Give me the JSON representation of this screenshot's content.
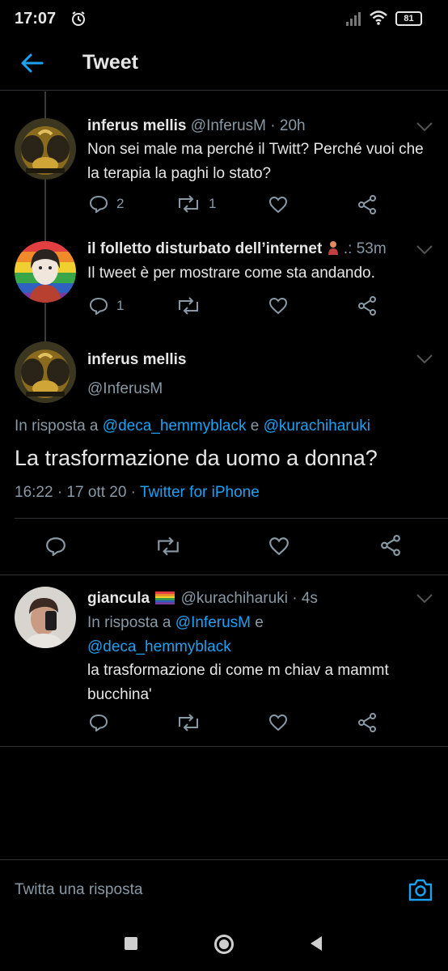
{
  "status_bar": {
    "time": "17:07",
    "battery": "81"
  },
  "header": {
    "title": "Tweet",
    "back_icon": "arrow-left-icon"
  },
  "tweets": [
    {
      "name": "inferus mellis",
      "handle": "@InferusM",
      "time": "· 20h",
      "text": "Non sei male ma perché il Twitt? Perché vuoi che la terapia la paghi lo stato?",
      "replies": "2",
      "retweets": "1"
    },
    {
      "name": "il folletto disturbato dell’internet",
      "handle_truncated": ".:",
      "time": "53m",
      "text": "Il tweet è per mostrare come sta andando.",
      "replies": "1",
      "retweets": ""
    }
  ],
  "main_tweet": {
    "name": "inferus mellis",
    "handle": "@InferusM",
    "reply_prefix": "In risposta a",
    "reply_to_1": "@deca_hemmyblack",
    "reply_joiner": "e",
    "reply_to_2": "@kurachiharuki",
    "text": "La trasformazione da uomo a donna?",
    "timestamp": "16:22 · 17 ott 20 ·",
    "source": "Twitter for iPhone"
  },
  "reply_tweet": {
    "name": "giancula",
    "handle": "@kurachiharuki",
    "time": "· 4s",
    "reply_prefix": "In risposta a",
    "reply_to_1": "@InferusM",
    "reply_joiner": "e",
    "reply_to_2": "@deca_hemmyblack",
    "text": "la trasformazione di come m chiav a mammt bucchina'"
  },
  "composer": {
    "placeholder": "Twitta una risposta"
  },
  "colors": {
    "accent": "#1da1f2",
    "background": "#000000",
    "muted": "#8899a6",
    "text": "#e6e6e6"
  }
}
